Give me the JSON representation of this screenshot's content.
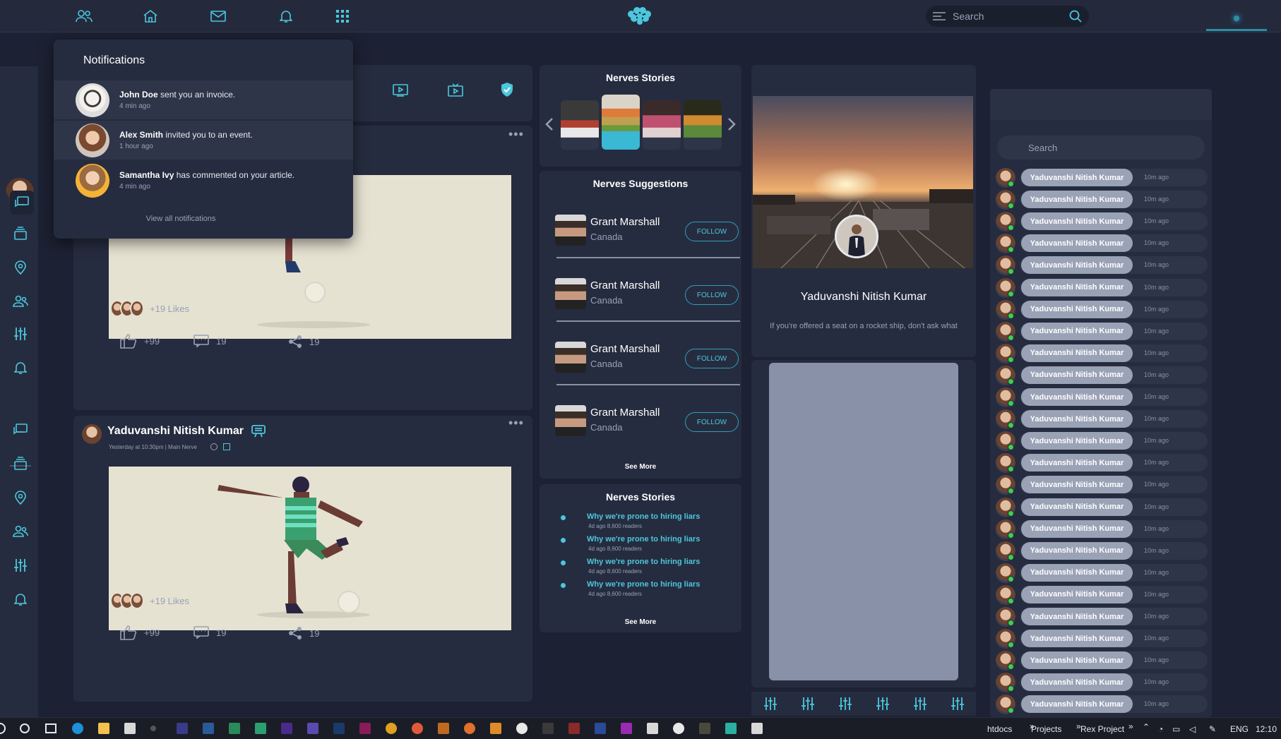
{
  "top_nav": {
    "icons": [
      "friends-icon",
      "home-icon",
      "mail-icon",
      "bell-icon",
      "apps-grid-icon"
    ],
    "search_placeholder": "Search"
  },
  "notifications": {
    "title": "Notifications",
    "items": [
      {
        "name": "John Doe",
        "text": "sent you an invoice.",
        "time": "4 min ago"
      },
      {
        "name": "Alex Smith",
        "text": "invited you to an event.",
        "time": "1 hour ago"
      },
      {
        "name": "Samantha Ivy",
        "text": "has commented on your article.",
        "time": "4 min ago"
      }
    ],
    "view_all": "View all notifications"
  },
  "posts": [
    {
      "author": "",
      "meta": "",
      "likes_label": "+19 Likes",
      "like_count": "+99",
      "comment_count": "19",
      "share_count": "19"
    },
    {
      "author": "Yaduvanshi Nitish Kumar",
      "meta": "Yesterday at 10:30pm | Main Nerve",
      "likes_label": "+19 Likes",
      "like_count": "+99",
      "comment_count": "19",
      "share_count": "19"
    }
  ],
  "stories_top": {
    "title": "Nerves Stories"
  },
  "suggestions": {
    "title": "Nerves Suggestions",
    "items": [
      {
        "name": "Grant Marshall",
        "country": "Canada",
        "button": "FOLLOW"
      },
      {
        "name": "Grant Marshall",
        "country": "Canada",
        "button": "FOLLOW"
      },
      {
        "name": "Grant Marshall",
        "country": "Canada",
        "button": "FOLLOW"
      },
      {
        "name": "Grant Marshall",
        "country": "Canada",
        "button": "FOLLOW"
      }
    ],
    "see_more": "See More"
  },
  "stories_list": {
    "title": "Nerves Stories",
    "items": [
      {
        "title": "Why we're prone to hiring liars",
        "meta": "4d ago    8,600 readers"
      },
      {
        "title": "Why we're prone to hiring liars",
        "meta": "4d ago    8,600 readers"
      },
      {
        "title": "Why we're prone to hiring liars",
        "meta": "4d ago    8,600 readers"
      },
      {
        "title": "Why we're prone to hiring liars",
        "meta": "4d ago    8,600 readers"
      }
    ],
    "see_more": "See More"
  },
  "profile": {
    "name": "Yaduvanshi Nitish Kumar",
    "bio": "If you're offered a seat on a rocket ship, don't ask what"
  },
  "chat": {
    "search_placeholder": "Search",
    "contact_name": "Yaduvanshi Nitish Kumar",
    "contact_time": "10m ago",
    "count": 25
  },
  "taskbar": {
    "folders": [
      "htdocs",
      "Projects",
      "Rex Project"
    ],
    "language": "ENG",
    "clock": "12:10"
  },
  "colors": {
    "background": "#1c2133",
    "panel": "#262c3f",
    "accent": "#4cc7dd",
    "online": "#3bd14a"
  }
}
